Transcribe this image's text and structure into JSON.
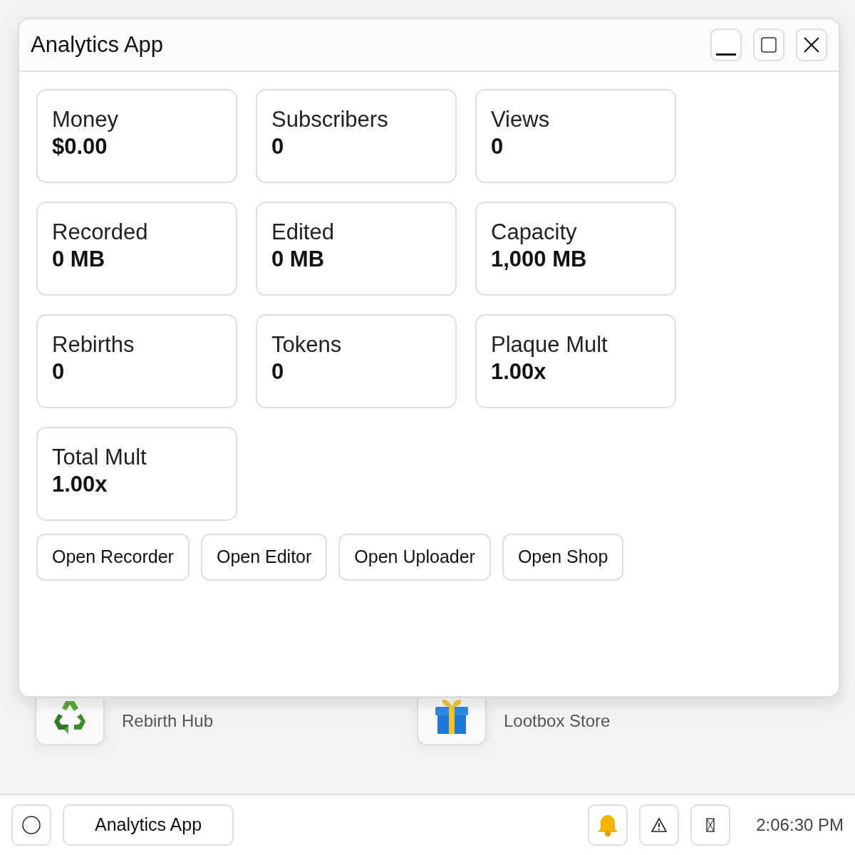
{
  "desktop_items": [
    {
      "subtitle": "Rebirth Hub",
      "kind": "recycle"
    },
    {
      "subtitle": "Lootbox Store",
      "kind": "gift"
    }
  ],
  "window": {
    "title": "Analytics App"
  },
  "stats": [
    {
      "label": "Money",
      "value": "$0.00"
    },
    {
      "label": "Subscribers",
      "value": "0"
    },
    {
      "label": "Views",
      "value": "0"
    },
    {
      "label": "Recorded",
      "value": "0 MB"
    },
    {
      "label": "Edited",
      "value": "0 MB"
    },
    {
      "label": "Capacity",
      "value": "1,000 MB"
    },
    {
      "label": "Rebirths",
      "value": "0"
    },
    {
      "label": "Tokens",
      "value": "0"
    },
    {
      "label": "Plaque Mult",
      "value": "1.00x"
    },
    {
      "label": "Total Mult",
      "value": "1.00x"
    }
  ],
  "buttons": [
    "Open Recorder",
    "Open Editor",
    "Open Uploader",
    "Open Shop"
  ],
  "taskbar": {
    "apps": [
      "Analytics App"
    ],
    "tray": [
      {
        "kind": "bell"
      },
      {
        "kind": "warning"
      },
      {
        "kind": "missing"
      }
    ],
    "clock": "2:06:30 PM"
  }
}
